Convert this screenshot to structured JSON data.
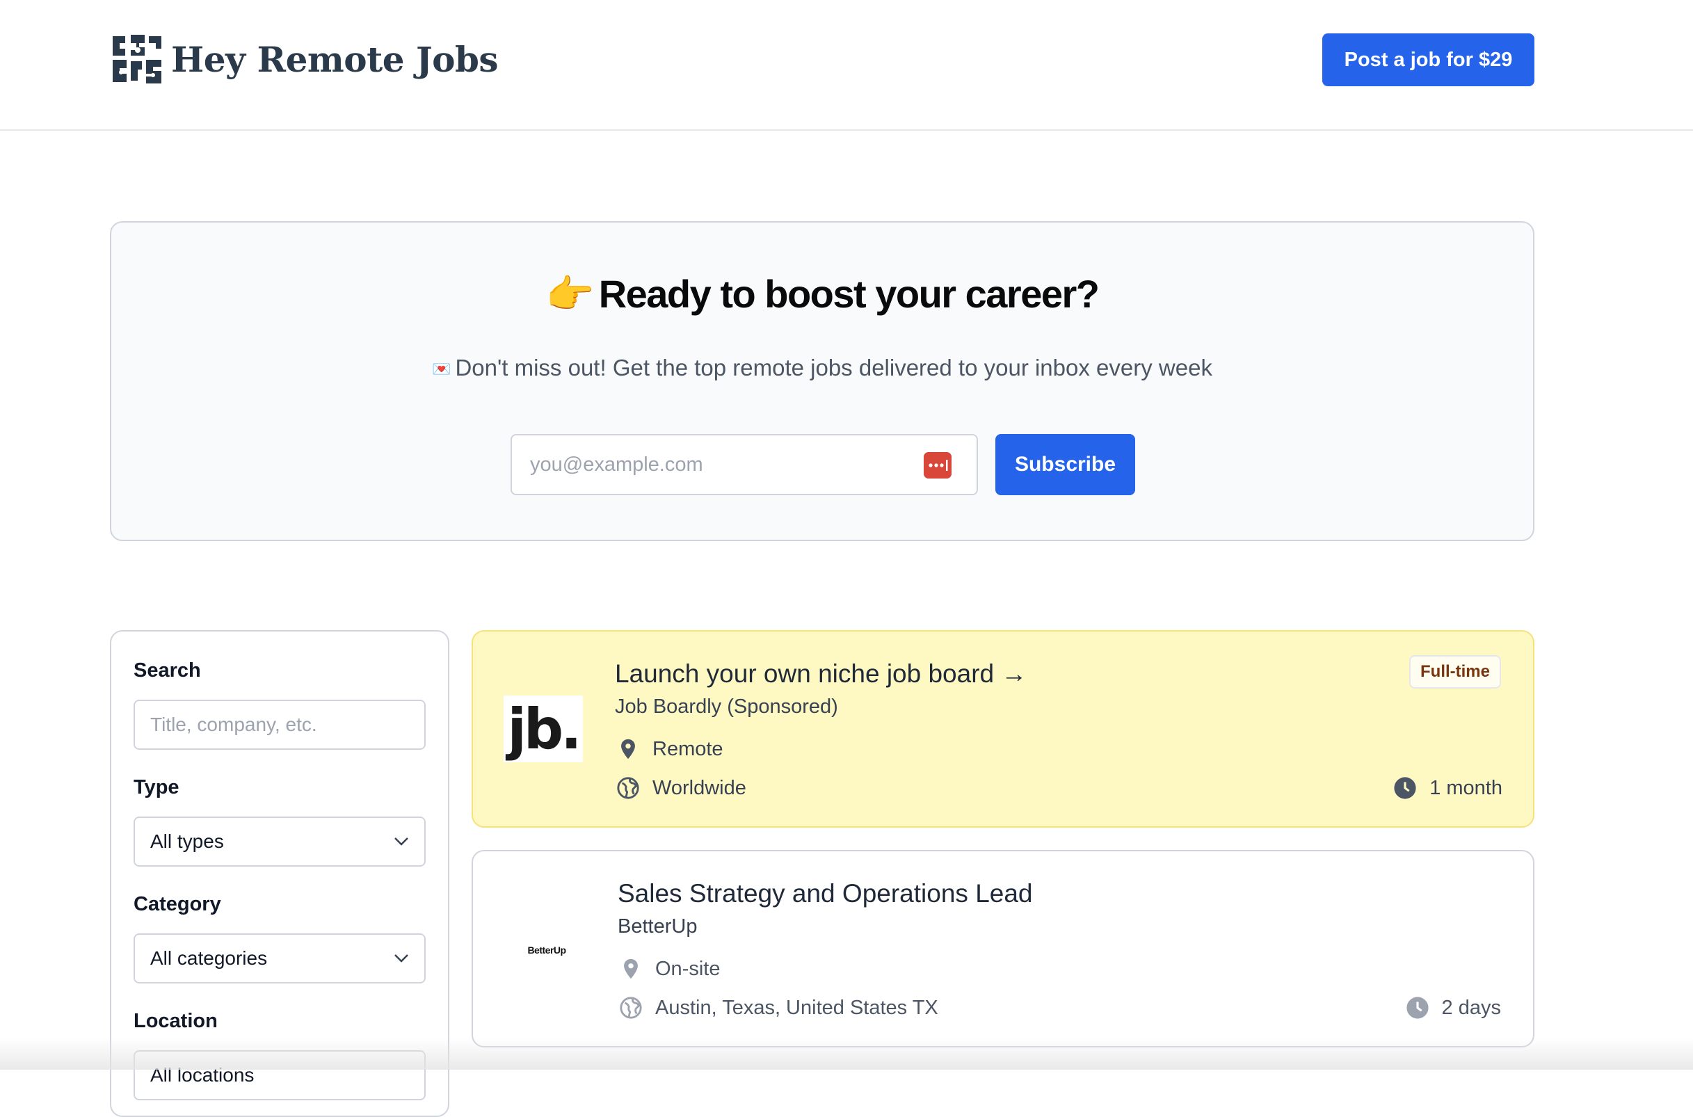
{
  "header": {
    "brand": "Hey Remote Jobs",
    "post_job_label": "Post a job for $29"
  },
  "newsletter": {
    "title_emoji": "👉",
    "title": "Ready to boost your career?",
    "subtitle_emoji": "💌",
    "subtitle": "Don't miss out! Get the top remote jobs delivered to your inbox every week",
    "email_placeholder": "you@example.com",
    "subscribe_label": "Subscribe"
  },
  "filters": {
    "search_label": "Search",
    "search_placeholder": "Title, company, etc.",
    "type_label": "Type",
    "type_value": "All types",
    "category_label": "Category",
    "category_value": "All categories",
    "location_label": "Location",
    "location_value": "All locations"
  },
  "jobs": [
    {
      "title": "Launch your own niche job board →",
      "company": "Job Boardly (Sponsored)",
      "logo_text": "jb.",
      "workplace": "Remote",
      "region": "Worldwide",
      "age": "1 month",
      "type_badge": "Full-time",
      "featured": true
    },
    {
      "title": "Sales Strategy and Operations Lead",
      "company": "BetterUp",
      "logo_text": "BetterUp",
      "workplace": "On-site",
      "region": "Austin, Texas, United States TX",
      "age": "2 days",
      "featured": false
    }
  ],
  "colors": {
    "accent": "#2563eb",
    "featured_bg": "#fef9c3",
    "brand_text": "#2b3a4a"
  },
  "icons": [
    "map-pin-icon",
    "globe-icon",
    "clock-icon",
    "chevron-down-icon",
    "password-manager-icon",
    "pointing-hand-emoji",
    "love-letter-emoji"
  ]
}
